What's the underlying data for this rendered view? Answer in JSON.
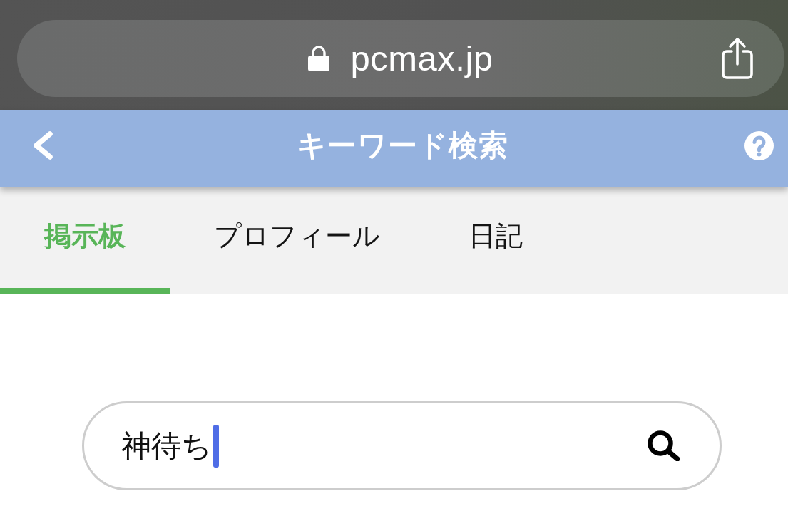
{
  "browser_bar": {
    "url": "pcmax.jp"
  },
  "header": {
    "title": "キーワード検索"
  },
  "tabs": [
    {
      "label": "掲示板",
      "selected": true
    },
    {
      "label": "プロフィール",
      "selected": false
    },
    {
      "label": "日記",
      "selected": false
    }
  ],
  "search": {
    "value": "神待ち",
    "focused": true
  }
}
